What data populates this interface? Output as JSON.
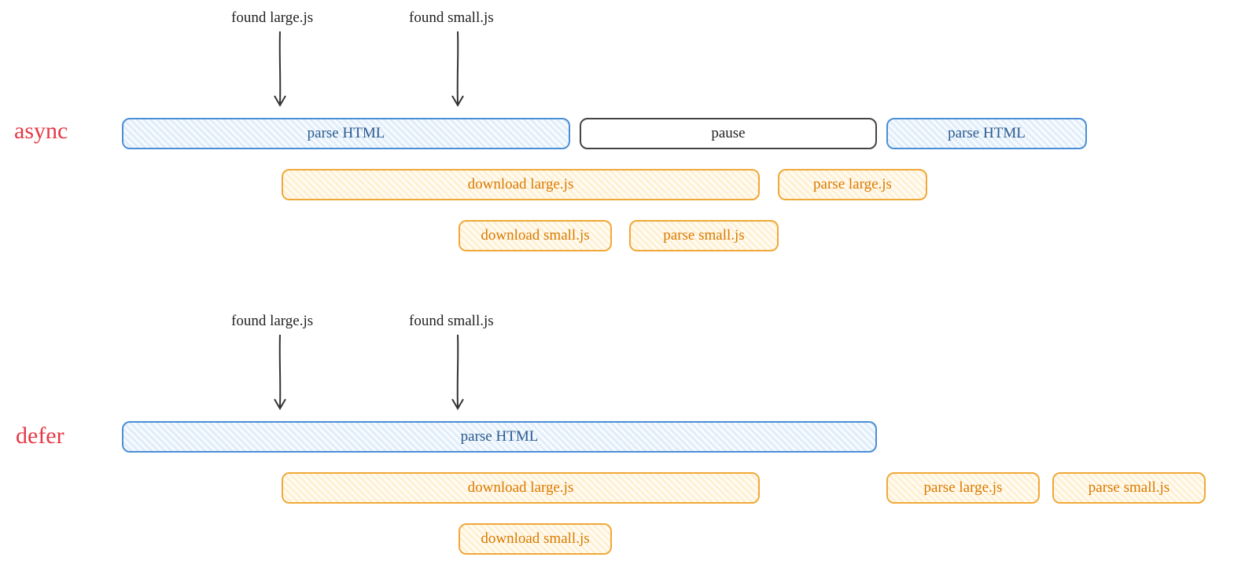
{
  "sections": {
    "async": {
      "label": "async"
    },
    "defer": {
      "label": "defer"
    }
  },
  "annotations": {
    "found_large_1": "found large.js",
    "found_small_1": "found small.js",
    "found_large_2": "found large.js",
    "found_small_2": "found small.js"
  },
  "boxes": {
    "async_parse1": "parse HTML",
    "async_pause": "pause",
    "async_parse2": "parse HTML",
    "async_dl_large": "download large.js",
    "async_parse_large": "parse large.js",
    "async_dl_small": "download small.js",
    "async_parse_small": "parse small.js",
    "defer_parse": "parse HTML",
    "defer_dl_large": "download large.js",
    "defer_parse_large": "parse large.js",
    "defer_parse_small": "parse small.js",
    "defer_dl_small": "download small.js"
  },
  "chart_data": {
    "type": "timeline",
    "description": "Comparison of async vs defer script loading timelines (relative time units)",
    "scenarios": [
      {
        "name": "async",
        "tracks": [
          {
            "track": "main",
            "segments": [
              {
                "label": "parse HTML",
                "start": 0,
                "end": 570,
                "kind": "parse"
              },
              {
                "label": "pause",
                "start": 580,
                "end": 960,
                "kind": "pause"
              },
              {
                "label": "parse HTML",
                "start": 970,
                "end": 1225,
                "kind": "parse"
              }
            ]
          },
          {
            "track": "large.js",
            "segments": [
              {
                "label": "download large.js",
                "start": 200,
                "end": 810,
                "kind": "download"
              },
              {
                "label": "parse large.js",
                "start": 830,
                "end": 1020,
                "kind": "exec"
              }
            ]
          },
          {
            "track": "small.js",
            "segments": [
              {
                "label": "download small.js",
                "start": 425,
                "end": 620,
                "kind": "download"
              },
              {
                "label": "parse small.js",
                "start": 640,
                "end": 830,
                "kind": "exec"
              }
            ]
          }
        ],
        "events": [
          {
            "label": "found large.js",
            "at": 200
          },
          {
            "label": "found small.js",
            "at": 425
          }
        ]
      },
      {
        "name": "defer",
        "tracks": [
          {
            "track": "main",
            "segments": [
              {
                "label": "parse HTML",
                "start": 0,
                "end": 960,
                "kind": "parse"
              }
            ]
          },
          {
            "track": "large.js",
            "segments": [
              {
                "label": "download large.js",
                "start": 200,
                "end": 810,
                "kind": "download"
              },
              {
                "label": "parse large.js",
                "start": 970,
                "end": 1165,
                "kind": "exec"
              }
            ]
          },
          {
            "track": "small.js",
            "segments": [
              {
                "label": "download small.js",
                "start": 425,
                "end": 620,
                "kind": "download"
              },
              {
                "label": "parse small.js",
                "start": 1180,
                "end": 1375,
                "kind": "exec"
              }
            ]
          }
        ],
        "events": [
          {
            "label": "found large.js",
            "at": 200
          },
          {
            "label": "found small.js",
            "at": 425
          }
        ]
      }
    ]
  }
}
